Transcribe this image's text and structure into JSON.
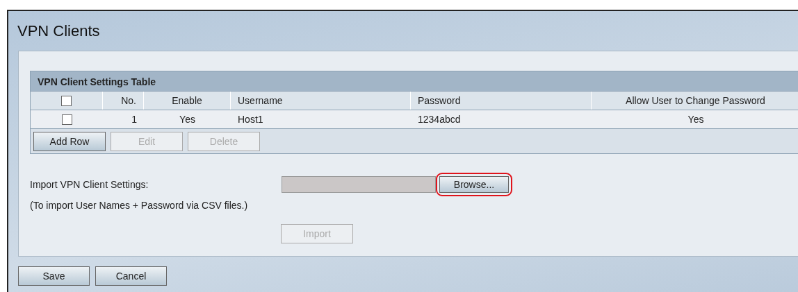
{
  "page": {
    "title": "VPN Clients"
  },
  "table": {
    "title": "VPN Client Settings Table",
    "select_all_checked": false,
    "columns": [
      {
        "label": "No.",
        "kind": "number"
      },
      {
        "label": "Enable",
        "kind": "center"
      },
      {
        "label": "Username",
        "kind": "left"
      },
      {
        "label": "Password",
        "kind": "left"
      },
      {
        "label": "Allow User to Change Password",
        "kind": "center"
      }
    ],
    "rows": [
      {
        "checked": false,
        "cells": [
          "1",
          "Yes",
          "Host1",
          "1234abcd",
          "Yes"
        ]
      }
    ],
    "buttons": [
      {
        "label": "Add Row",
        "disabled": false
      },
      {
        "label": "Edit",
        "disabled": true
      },
      {
        "label": "Delete",
        "disabled": true
      }
    ]
  },
  "import": {
    "label": "Import VPN Client Settings:",
    "note": "(To import User Names + Password via CSV files.)",
    "browse": {
      "label": "Browse...",
      "highlighted": true
    },
    "import_button": {
      "label": "Import",
      "disabled": true
    }
  },
  "footer_buttons": [
    {
      "label": "Save",
      "disabled": false
    },
    {
      "label": "Cancel",
      "disabled": false
    }
  ]
}
